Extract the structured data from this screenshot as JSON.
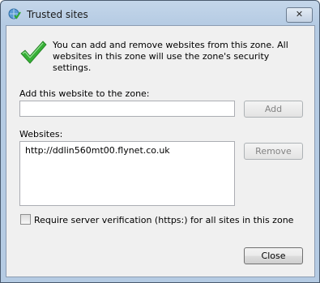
{
  "window": {
    "title": "Trusted sites",
    "close_glyph": "✕"
  },
  "info": {
    "message": "You can add and remove websites from this zone. All websites in this zone will use the zone's security settings."
  },
  "add_section": {
    "label": "Add this website to the zone:",
    "value": "",
    "add_button": "Add"
  },
  "websites": {
    "label": "Websites:",
    "items": [
      "http://ddlin560mt00.flynet.co.uk"
    ],
    "remove_button": "Remove"
  },
  "verification": {
    "label": "Require server verification (https:) for all sites in this zone",
    "checked": false
  },
  "footer": {
    "close_button": "Close"
  },
  "icons": {
    "title": "globe-check-icon",
    "info": "green-checkmark-icon"
  },
  "colors": {
    "title_bar": "#b5cbe3",
    "dialog_bg": "#f0f0f0",
    "checkmark": "#2fa92f"
  }
}
